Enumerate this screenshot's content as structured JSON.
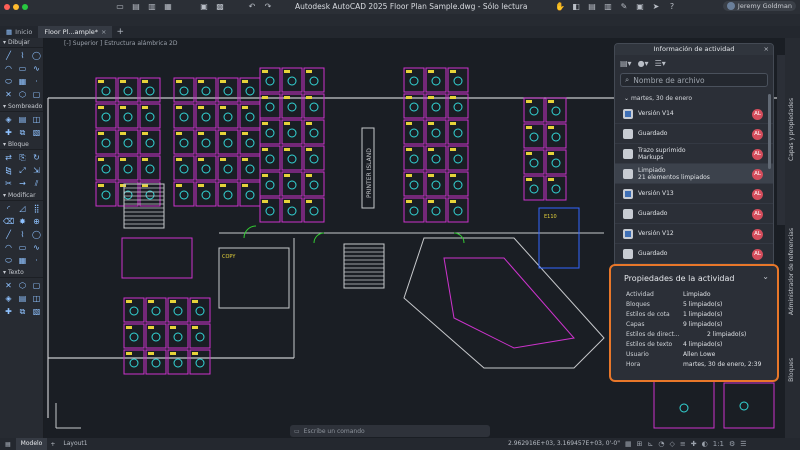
{
  "titlebar": {
    "title": "Autodesk AutoCAD 2025   Floor Plan Sample.dwg - Sólo lectura",
    "user_name": "Jeremy Goldman",
    "traffic_colors": [
      "#ff5f57",
      "#febc2e",
      "#28c840"
    ],
    "toolbar_icons": [
      "folder-icon",
      "open-icon",
      "save-icon",
      "save-as-icon",
      "print-icon",
      "plot-icon",
      "undo-icon",
      "redo-icon",
      "pan-icon",
      "share-icon"
    ]
  },
  "tabs": {
    "home": "Inicio",
    "drawing": "Floor Pl...ample*",
    "add": "+"
  },
  "viewport": {
    "label": "[-] Superior ] Estructura alámbrica 2D"
  },
  "palette": {
    "sections": [
      {
        "name": "Dibujar",
        "icons": [
          "line-icon",
          "polyline-icon",
          "circle-icon",
          "arc-icon",
          "rectangle-icon",
          "spline-icon",
          "ellipse-icon",
          "hatch-icon",
          "point-icon",
          "construction-line-icon",
          "polygon-icon",
          "region-icon"
        ]
      },
      {
        "name": "Sombreado",
        "icons": [
          "hatch-pattern-icon",
          "gradient-icon",
          "boundary-icon",
          "wipeout-icon",
          "revcloud-icon",
          "table-icon"
        ]
      },
      {
        "name": "Bloque",
        "icons": [
          "insert-block-icon",
          "create-block-icon",
          "edit-block-icon",
          "attribute-icon",
          "write-block-icon",
          "base-point-icon",
          "define-attribute-icon",
          "block-editor-icon",
          "palette-icon"
        ]
      },
      {
        "name": "Modificar",
        "icons": [
          "move-icon",
          "copy-icon",
          "rotate-icon",
          "mirror-icon",
          "scale-icon",
          "stretch-icon",
          "trim-icon",
          "extend-icon",
          "offset-icon",
          "fillet-icon",
          "chamfer-icon",
          "array-icon",
          "erase-icon",
          "explode-icon",
          "join-icon"
        ]
      },
      {
        "name": "Texto",
        "icons": [
          "mtext-icon",
          "text-icon",
          "dimension-icon",
          "leader-icon",
          "table-text-icon",
          "field-icon",
          "spell-check-icon",
          "find-icon",
          "style-icon"
        ]
      }
    ]
  },
  "activity_panel": {
    "title": "Información de actividad",
    "search_placeholder": "Nombre de archivo",
    "date_header": "martes, 30 de enero",
    "items": [
      {
        "title": "Versión V14",
        "subtitle": "",
        "badge": "AL",
        "icon": "version-icon"
      },
      {
        "title": "Guardado",
        "subtitle": "",
        "badge": "AL",
        "icon": "save-icon"
      },
      {
        "title": "Trazo suprimido",
        "subtitle": "Markups",
        "badge": "AL",
        "icon": "markup-icon"
      },
      {
        "title": "Limpiado",
        "subtitle": "21 elementos limpiados",
        "badge": "AL",
        "icon": "purge-icon"
      },
      {
        "title": "Versión V13",
        "subtitle": "",
        "badge": "AL",
        "icon": "version-icon"
      },
      {
        "title": "Guardado",
        "subtitle": "",
        "badge": "AL",
        "icon": "save-icon"
      },
      {
        "title": "Versión V12",
        "subtitle": "",
        "badge": "AL",
        "icon": "version-icon"
      },
      {
        "title": "Guardado",
        "subtitle": "",
        "badge": "AL",
        "icon": "save-icon"
      }
    ]
  },
  "properties_panel": {
    "title": "Propiedades de la actividad",
    "rows": [
      {
        "label": "Actividad",
        "value": "Limpiado"
      },
      {
        "label": "Bloques",
        "value": "5 limpiado(s)"
      },
      {
        "label": "Estilos de cota",
        "value": "1 limpiado(s)"
      },
      {
        "label": "Capas",
        "value": "9 limpiado(s)"
      },
      {
        "label": "Estilos de direct...",
        "value": "2 limpiado(s)"
      },
      {
        "label": "Estilos de texto",
        "value": "4 limpiado(s)"
      },
      {
        "label": "Usuario",
        "value": "Allen Lowe"
      },
      {
        "label": "Hora",
        "value": "martes, 30 de enero, 2:39"
      }
    ],
    "highlight_color": "#e8772a"
  },
  "right_rail": {
    "labels": [
      "Capas y propiedades",
      "Administrador de referencias",
      "Bloques"
    ]
  },
  "command_line": {
    "placeholder": "Escribe un comando"
  },
  "status": {
    "model_tab": "Modelo",
    "layout_tab": "Layout1",
    "coordinates": "2.962916E+03, 3.169457E+03, 0'-0\"",
    "scale": "1:1"
  },
  "drawing": {
    "labels": [
      "PRINTER ISLAND",
      "COPY",
      "E110"
    ],
    "colors": {
      "walls": "#c7c9cc",
      "partitions": "#cc33cc",
      "furniture": "#33d6d6",
      "tags": "#e6d23a",
      "doors": "#33cc33",
      "equipment": "#3366ff"
    }
  }
}
